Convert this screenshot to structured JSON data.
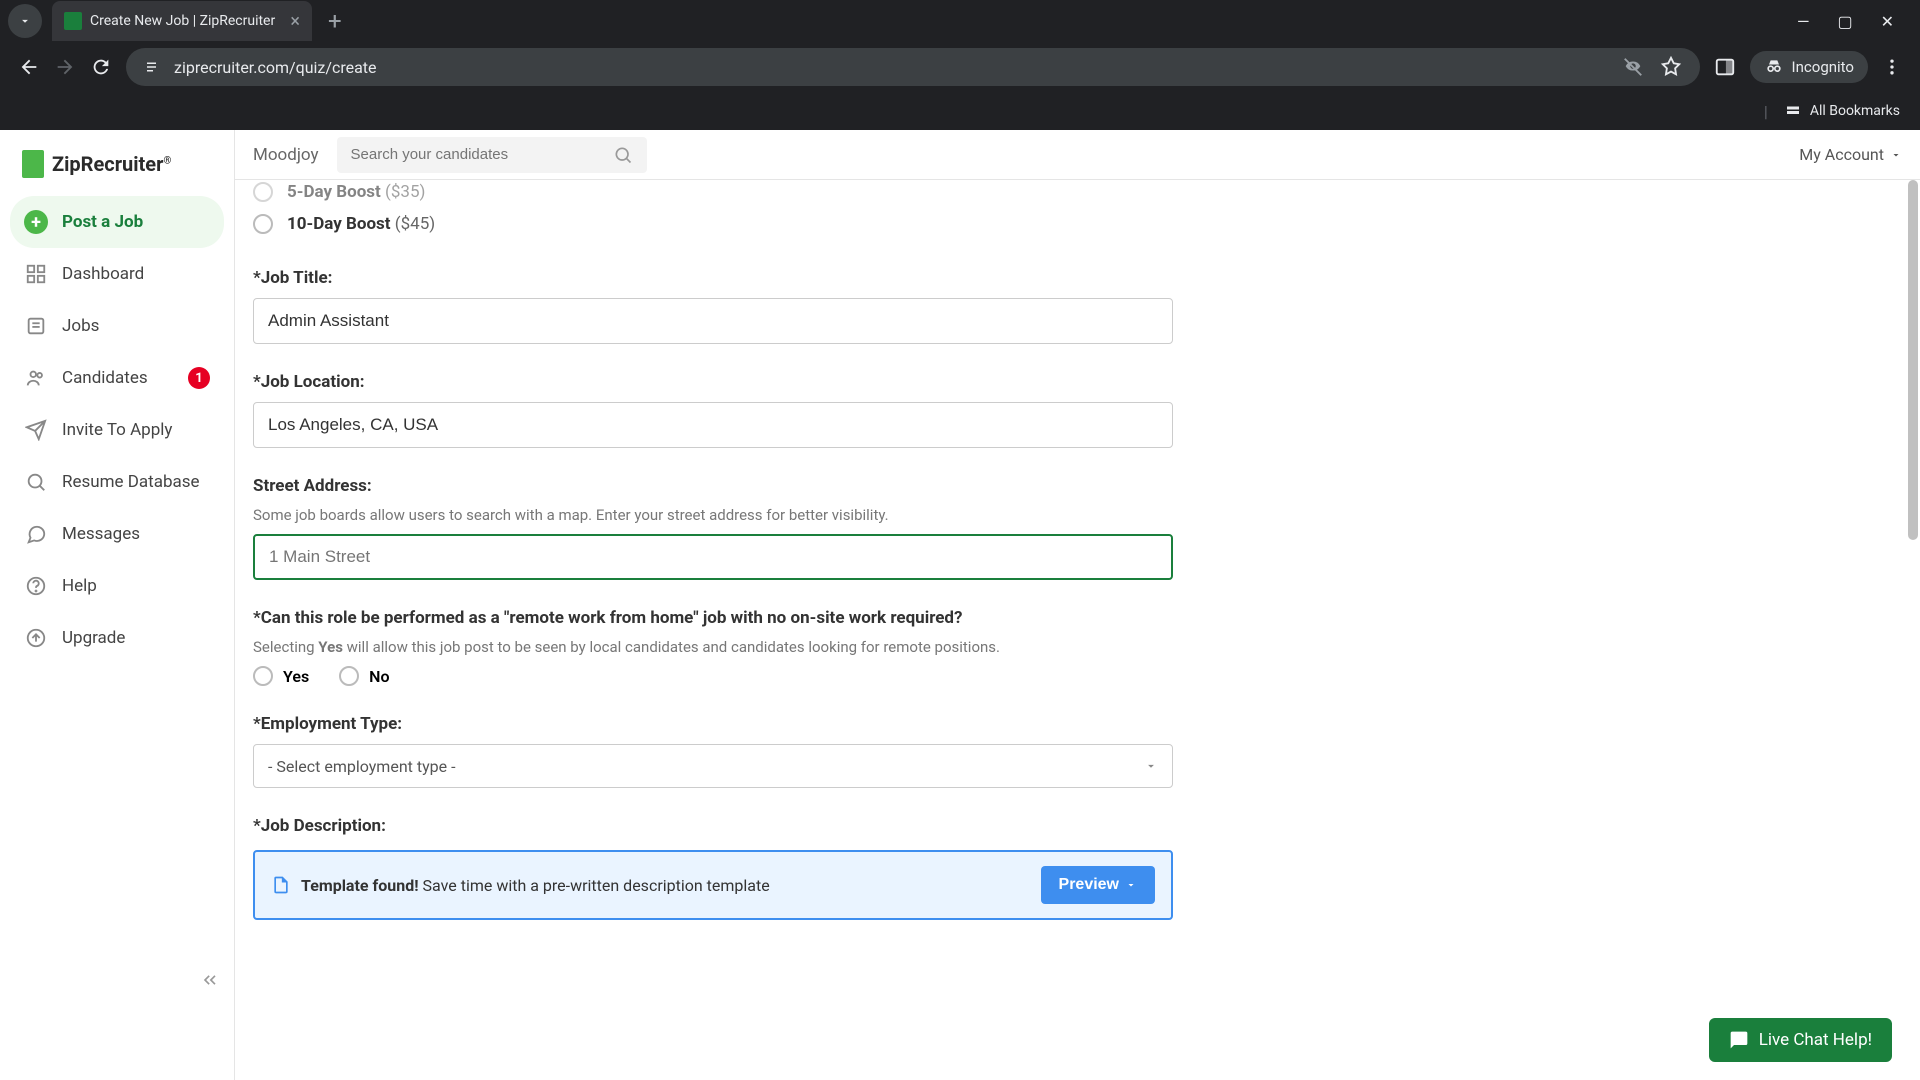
{
  "browser": {
    "tab_title": "Create New Job | ZipRecruiter",
    "url": "ziprecruiter.com/quiz/create",
    "incognito_label": "Incognito",
    "bookmarks_label": "All Bookmarks"
  },
  "logo": {
    "text": "ZipRecruiter"
  },
  "sidebar": {
    "post_job": "Post a Job",
    "dashboard": "Dashboard",
    "jobs": "Jobs",
    "candidates": "Candidates",
    "candidates_badge": "1",
    "invite": "Invite To Apply",
    "resume_db": "Resume Database",
    "messages": "Messages",
    "help": "Help",
    "upgrade": "Upgrade"
  },
  "topbar": {
    "company": "Moodjoy",
    "search_placeholder": "Search your candidates",
    "account": "My Account"
  },
  "form": {
    "boost5": {
      "label": "5-Day Boost",
      "price": " ($35)"
    },
    "boost10": {
      "label": "10-Day Boost",
      "price": " ($45)"
    },
    "job_title_label": "*Job Title:",
    "job_title_value": "Admin Assistant",
    "job_location_label": "*Job Location:",
    "job_location_value": "Los Angeles, CA, USA",
    "street_label": "Street Address:",
    "street_hint": "Some job boards allow users to search with a map. Enter your street address for better visibility.",
    "street_placeholder": "1 Main Street",
    "remote_label": "*Can this role be performed as a \"remote work from home\" job with no on-site work required?",
    "remote_hint_prefix": "Selecting ",
    "remote_hint_bold": "Yes",
    "remote_hint_suffix": " will allow this job post to be seen by local candidates and candidates looking for remote positions.",
    "yes": "Yes",
    "no": "No",
    "employment_type_label": "*Employment Type:",
    "employment_type_value": "- Select employment type -",
    "job_description_label": "*Job Description:",
    "template_bold": "Template found!",
    "template_text": " Save time with a pre-written description template",
    "preview": "Preview"
  },
  "chat": {
    "label": "Live Chat Help!"
  }
}
